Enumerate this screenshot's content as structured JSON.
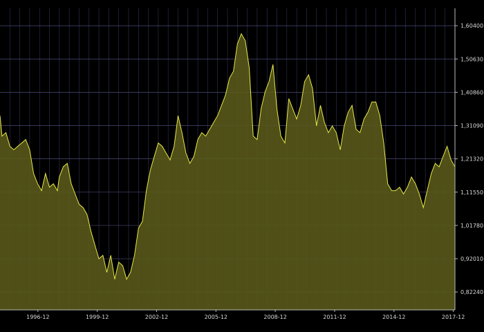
{
  "chart_data": {
    "type": "area",
    "title": "",
    "xlabel": "",
    "ylabel": "",
    "x_tick_labels": [
      "1996-12",
      "1999-12",
      "2002-12",
      "2005-12",
      "2008-12",
      "2011-12",
      "2014-12",
      "2017-12"
    ],
    "y_tick_labels": [
      "1,60400",
      "1,50630",
      "1,40860",
      "1,31090",
      "1,21320",
      "1,11550",
      "1,01780",
      "0,92010",
      "0,82240"
    ],
    "y_ticks": [
      1.604,
      1.5063,
      1.4086,
      1.3109,
      1.2132,
      1.1155,
      1.0178,
      0.9201,
      0.8224
    ],
    "xlim": [
      1995.0,
      2018.0
    ],
    "ylim": [
      0.77,
      1.655
    ],
    "grid": true,
    "colors": {
      "background": "#000000",
      "fill": "#5a5a1a",
      "line": "#e8e84a",
      "grid": "#4a4a7a"
    },
    "series": [
      {
        "x": [
          1995.0,
          1995.1,
          1995.3,
          1995.5,
          1995.7,
          1995.9,
          1996.1,
          1996.3,
          1996.5,
          1996.7,
          1996.9,
          1997.1,
          1997.3,
          1997.5,
          1997.7,
          1997.9,
          1998.0,
          1998.2,
          1998.4,
          1998.6,
          1998.8,
          1999.0,
          1999.2,
          1999.4,
          1999.6,
          1999.8,
          2000.0,
          2000.2,
          2000.4,
          2000.6,
          2000.8,
          2001.0,
          2001.2,
          2001.4,
          2001.6,
          2001.8,
          2002.0,
          2002.2,
          2002.4,
          2002.6,
          2002.8,
          2003.0,
          2003.2,
          2003.4,
          2003.6,
          2003.8,
          2004.0,
          2004.2,
          2004.4,
          2004.6,
          2004.8,
          2005.0,
          2005.2,
          2005.4,
          2005.6,
          2005.8,
          2006.0,
          2006.2,
          2006.4,
          2006.6,
          2006.8,
          2007.0,
          2007.2,
          2007.4,
          2007.6,
          2007.8,
          2008.0,
          2008.2,
          2008.4,
          2008.6,
          2008.8,
          2009.0,
          2009.2,
          2009.4,
          2009.6,
          2009.8,
          2010.0,
          2010.2,
          2010.4,
          2010.6,
          2010.8,
          2011.0,
          2011.2,
          2011.4,
          2011.6,
          2011.8,
          2012.0,
          2012.2,
          2012.4,
          2012.6,
          2012.8,
          2013.0,
          2013.2,
          2013.4,
          2013.6,
          2013.8,
          2014.0,
          2014.2,
          2014.4,
          2014.6,
          2014.8,
          2015.0,
          2015.2,
          2015.4,
          2015.6,
          2015.8,
          2016.0,
          2016.2,
          2016.4,
          2016.6,
          2016.8,
          2017.0,
          2017.2,
          2017.4,
          2017.6,
          2017.8,
          2018.0
        ],
        "values": [
          1.34,
          1.28,
          1.29,
          1.25,
          1.24,
          1.25,
          1.26,
          1.27,
          1.24,
          1.17,
          1.14,
          1.12,
          1.17,
          1.13,
          1.14,
          1.12,
          1.16,
          1.19,
          1.2,
          1.14,
          1.11,
          1.08,
          1.07,
          1.05,
          1.0,
          0.96,
          0.92,
          0.93,
          0.88,
          0.93,
          0.86,
          0.91,
          0.9,
          0.86,
          0.88,
          0.93,
          1.01,
          1.03,
          1.12,
          1.18,
          1.22,
          1.26,
          1.25,
          1.23,
          1.21,
          1.25,
          1.34,
          1.29,
          1.23,
          1.2,
          1.22,
          1.27,
          1.29,
          1.28,
          1.3,
          1.32,
          1.34,
          1.37,
          1.4,
          1.45,
          1.47,
          1.55,
          1.58,
          1.56,
          1.48,
          1.28,
          1.27,
          1.36,
          1.41,
          1.44,
          1.49,
          1.36,
          1.28,
          1.26,
          1.39,
          1.36,
          1.33,
          1.37,
          1.44,
          1.46,
          1.42,
          1.31,
          1.37,
          1.32,
          1.29,
          1.31,
          1.29,
          1.24,
          1.31,
          1.35,
          1.37,
          1.3,
          1.29,
          1.33,
          1.35,
          1.38,
          1.38,
          1.34,
          1.26,
          1.14,
          1.12,
          1.12,
          1.13,
          1.11,
          1.13,
          1.16,
          1.14,
          1.11,
          1.07,
          1.12,
          1.17,
          1.2,
          1.19,
          1.22,
          1.25,
          1.21,
          1.19
        ]
      }
    ]
  }
}
